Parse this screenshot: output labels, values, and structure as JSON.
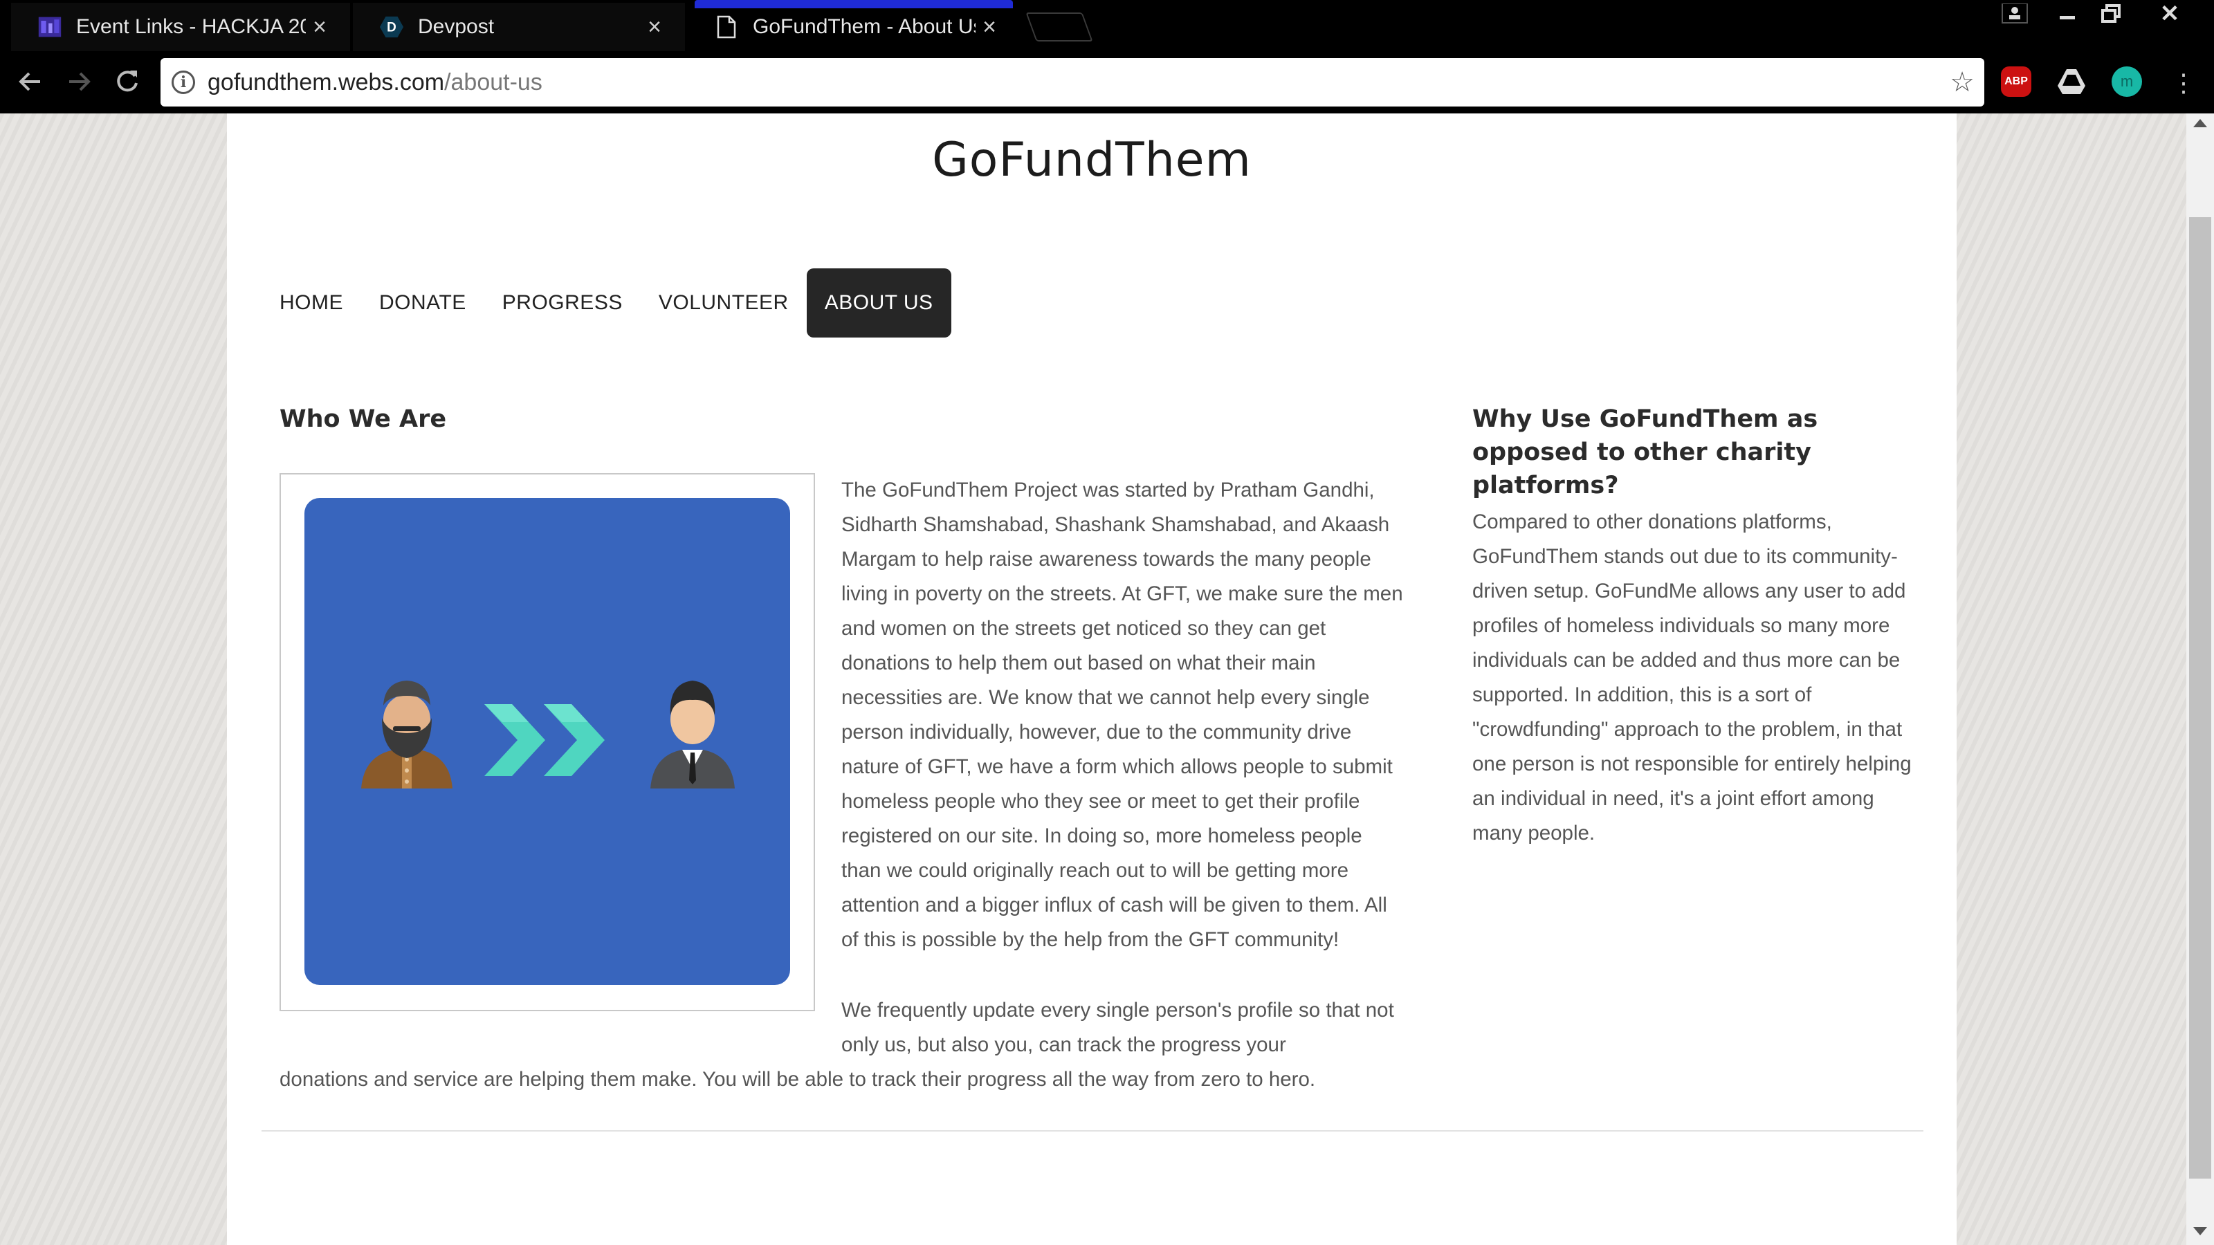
{
  "browser": {
    "tabs": [
      {
        "title": "Event Links - HACKJA 20",
        "favicon": "hackja-icon",
        "close": "×"
      },
      {
        "title": "Devpost",
        "favicon": "devpost-icon",
        "favicon_letter": "D",
        "close": "×"
      },
      {
        "title": "GoFundThem - About Us",
        "favicon": "page-icon",
        "close": "×"
      }
    ],
    "url_host": "gofundthem.webs.com",
    "url_path": "/about-us",
    "extensions": [
      {
        "name": "adblock-plus-icon",
        "label": "ABP",
        "color": "#cc1111"
      },
      {
        "name": "drive-icon"
      },
      {
        "name": "profile-extension-icon",
        "label": "m",
        "color": "#18b8a6"
      }
    ]
  },
  "page": {
    "site_title": "GoFundThem",
    "nav": [
      "HOME",
      "DONATE",
      "PROGRESS",
      "VOLUNTEER",
      "ABOUT US"
    ],
    "active_nav": "ABOUT US",
    "who_heading": "Who We Are",
    "who_paragraph_1": "The GoFundThem Project was started by Pratham Gandhi, Sidharth Shamshabad, Shashank Shamshabad, and Akaash Margam to help raise awareness towards the many people living in poverty on the streets. At GFT, we make sure the men and women on the streets get noticed so they can get donations to help them out based on what their main necessities are. We know that we cannot help every single person individually, however, due to the community drive nature of GFT, we have a form which allows people to submit homeless people who they see or meet to get their profile registered on our site. In doing so, more homeless people than we could originally reach out to will be getting more attention and a bigger influx of cash will be given to them. All of this is possible by the help from the GFT community!",
    "who_paragraph_2_a": "We frequently update every single person's profile so that not only us, but also you, can track the progress your",
    "who_paragraph_2_b": "donations and service are helping them make. You will be able to track their progress all the way from zero to hero.",
    "why_heading": "Why Use GoFundThem as opposed to other charity platforms?",
    "why_paragraph": "Compared to other donations platforms, GoFundThem stands out due to its community-driven setup. GoFundMe allows any user to add profiles of homeless individuals so many more individuals can be added and thus more can be supported. In addition, this is a sort of \"crowdfunding\" approach to the problem, in that one person is not responsible for entirely helping an individual in need, it's a joint effort among many people.",
    "image_bg_color": "#3865bd",
    "accent_teal": "#4fd6c0"
  }
}
